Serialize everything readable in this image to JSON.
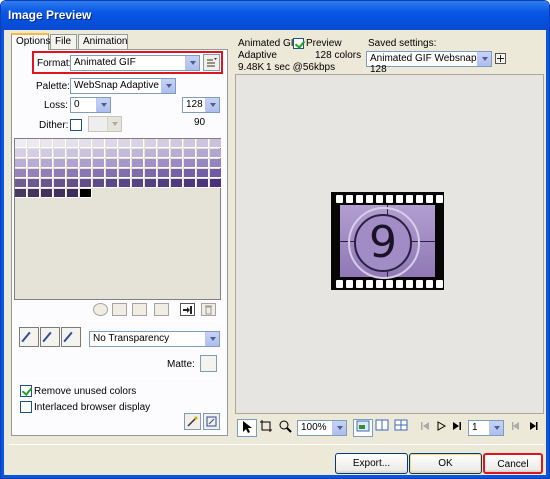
{
  "window": {
    "title": "Image Preview"
  },
  "tabs": [
    "Options",
    "File",
    "Animation"
  ],
  "options": {
    "format_label": "Format:",
    "format_value": "Animated GIF",
    "palette_label": "Palette:",
    "palette_value": "WebSnap Adaptive",
    "loss_label": "Loss:",
    "loss_value": "0",
    "colors_value": "128",
    "dither_label": "Dither:",
    "dither_checked": false,
    "dither_value": "90",
    "transparency_value": "No Transparency",
    "matte_label": "Matte:",
    "remove_unused_label": "Remove unused colors",
    "remove_unused_checked": true,
    "interlaced_label": "Interlaced browser display",
    "interlaced_checked": false
  },
  "info": {
    "format": "Animated GIF",
    "preview_label": "Preview",
    "preview_checked": true,
    "palette": "Adaptive",
    "colors": "128 colors",
    "size": "9.48K",
    "time": "1 sec @56kbps"
  },
  "saved_settings": {
    "label": "Saved settings:",
    "value": "Animated GIF Websnap 128"
  },
  "preview": {
    "frame_number": "9"
  },
  "bottom": {
    "zoom": "100%",
    "frame": "1"
  },
  "buttons": {
    "export": "Export...",
    "ok": "OK",
    "cancel": "Cancel"
  },
  "colors": {
    "accent": "#0a55e0",
    "highlight_border": "#e0141e",
    "preview_bg": "#e6e5e1"
  }
}
